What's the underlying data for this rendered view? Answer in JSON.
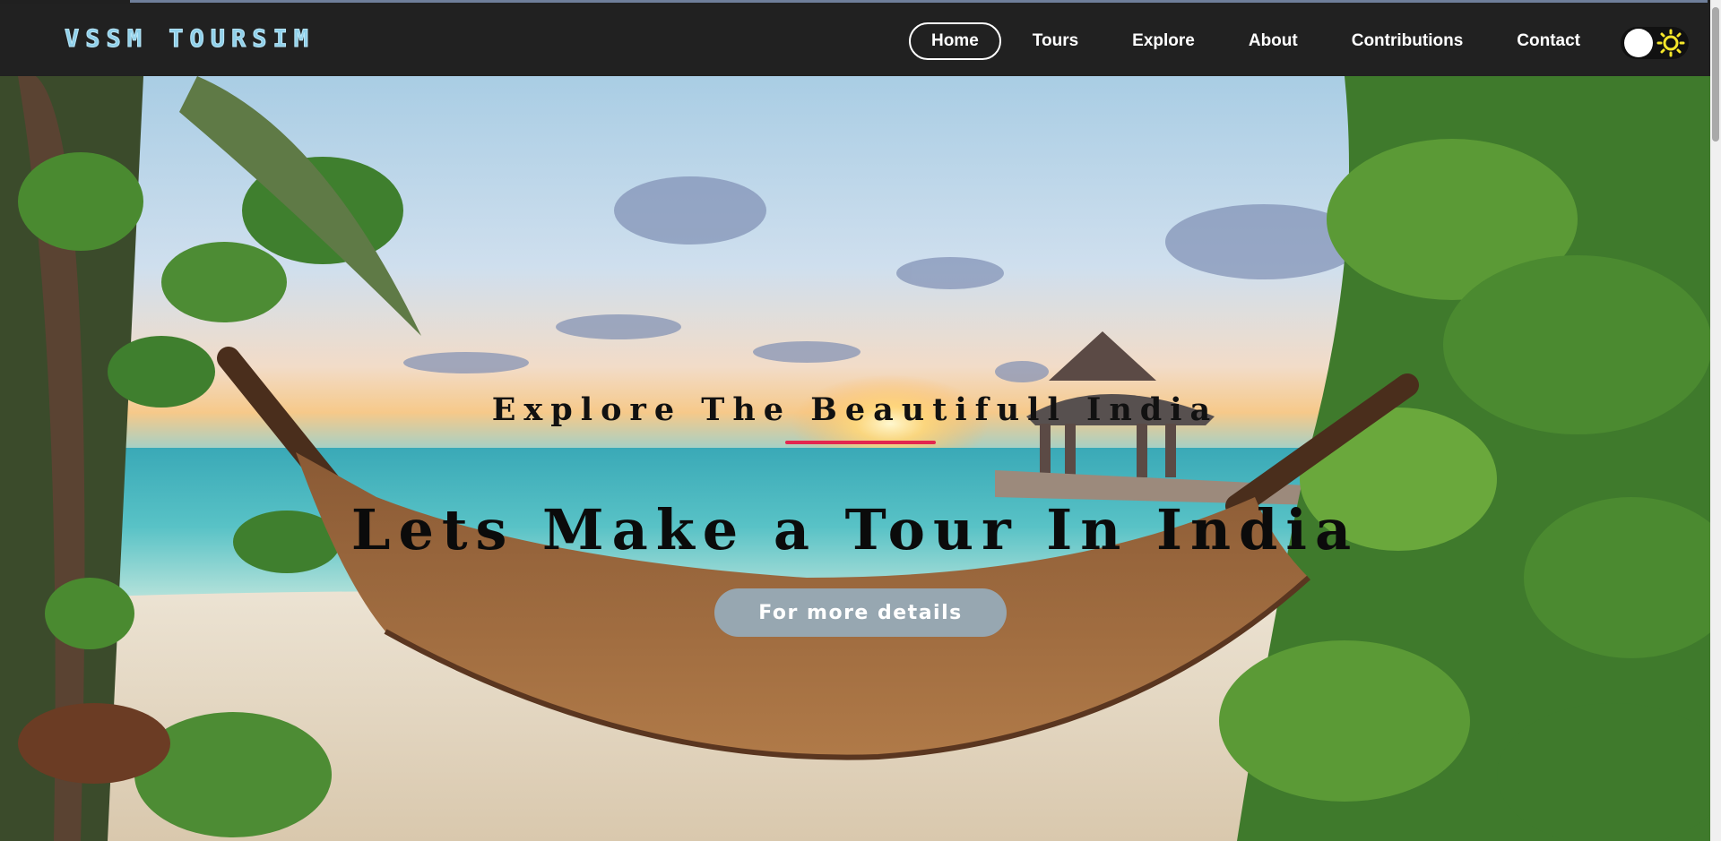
{
  "brand": {
    "name": "VSSM TOURSIM"
  },
  "nav": {
    "items": [
      {
        "label": "Home",
        "active": true
      },
      {
        "label": "Tours",
        "active": false
      },
      {
        "label": "Explore",
        "active": false
      },
      {
        "label": "About",
        "active": false
      },
      {
        "label": "Contributions",
        "active": false
      },
      {
        "label": "Contact",
        "active": false
      }
    ]
  },
  "theme_toggle": {
    "icon": "sun-icon",
    "state": "light"
  },
  "hero": {
    "subtitle": "Explore The Beautifull India",
    "title": "Lets Make a Tour In India",
    "cta_label": "For more details",
    "underline_color": "#e3264f"
  },
  "colors": {
    "navbar": "#212121",
    "brand": "#8fd0ea",
    "cta": "#97a7b1",
    "sun": "#f5e62a"
  }
}
